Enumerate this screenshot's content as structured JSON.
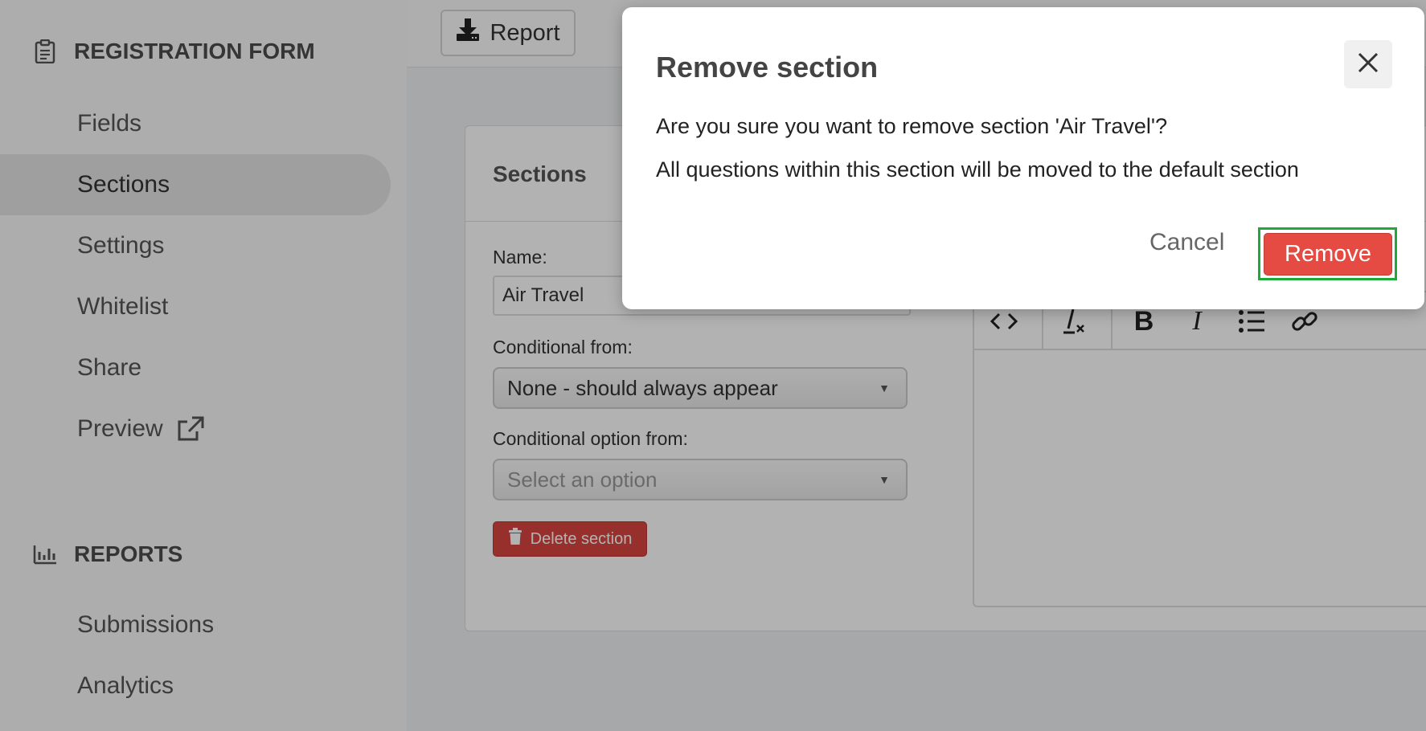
{
  "sidebar": {
    "form_heading": "REGISTRATION FORM",
    "form_items": [
      {
        "label": "Fields"
      },
      {
        "label": "Sections",
        "active": true
      },
      {
        "label": "Settings"
      },
      {
        "label": "Whitelist"
      },
      {
        "label": "Share"
      },
      {
        "label": "Preview"
      }
    ],
    "reports_heading": "REPORTS",
    "report_items": [
      {
        "label": "Submissions"
      },
      {
        "label": "Analytics"
      }
    ]
  },
  "topbar": {
    "report_label": "Report"
  },
  "panel": {
    "title": "Sections",
    "name_label": "Name:",
    "name_value": "Air Travel",
    "conditional_from_label": "Conditional from:",
    "conditional_from_value": "None - should always appear",
    "conditional_option_label": "Conditional option from:",
    "conditional_option_placeholder": "Select an option",
    "delete_label": "Delete section"
  },
  "editor": {
    "toolbar_bold": "B",
    "toolbar_italic": "I"
  },
  "modal": {
    "title": "Remove section",
    "message": "Are you sure you want to remove section 'Air Travel'?",
    "note": "All questions within this section will be moved to the default section",
    "cancel_label": "Cancel",
    "remove_label": "Remove"
  },
  "colors": {
    "danger": "#e54b42",
    "highlight": "#1fa93a",
    "overlay": "rgba(0,0,0,0.3)"
  }
}
